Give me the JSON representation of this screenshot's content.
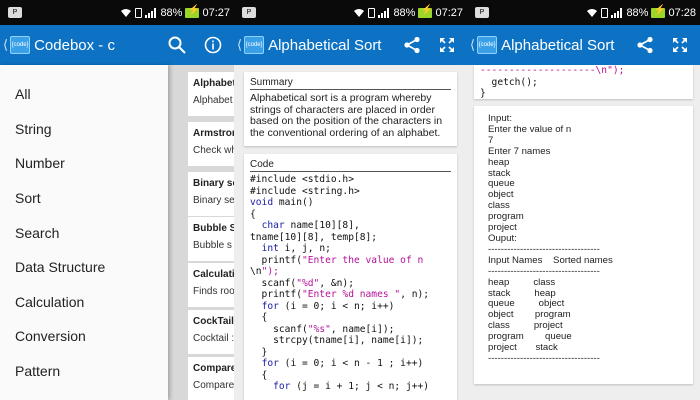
{
  "status_bars": [
    {
      "battery": "88%",
      "time": "07:27"
    },
    {
      "battery": "88%",
      "time": "07:27"
    },
    {
      "battery": "88%",
      "time": "07:28"
    }
  ],
  "app_icon_label": "{code}",
  "screen1": {
    "title": "Codebox - c",
    "menu": [
      "All",
      "String",
      "Number",
      "Sort",
      "Search",
      "Data Structure",
      "Calculation",
      "Conversion",
      "Pattern"
    ],
    "cards": [
      {
        "title": "Alphabet",
        "sub": "Alphabet"
      },
      {
        "title": "Armstror",
        "sub": "Check wh"
      },
      {
        "title": "Binary se",
        "sub": "Binary se"
      },
      {
        "title": "Bubble S",
        "sub": "Bubble s"
      },
      {
        "title": "Calculati",
        "sub": "Finds roo"
      },
      {
        "title": "CockTail",
        "sub": "Cocktail :"
      },
      {
        "title": "Compare",
        "sub": "Compare"
      }
    ]
  },
  "screen2": {
    "title": "Alphabetical Sort",
    "summary_heading": "Summary",
    "summary_text": "Alphabetical sort is a program whereby strings of characters are placed in order based on the position of the characters in the conventional ordering of an alphabet.",
    "code_heading": "Code",
    "code_lines": [
      "#include <stdio.h>",
      "#include <string.h>",
      "void main()",
      "{",
      "  char name[10][8],",
      "tname[10][8], temp[8];",
      "  int i, j, n;",
      "  printf(\"Enter the value of n",
      "\\n\");",
      "  scanf(\"%d\", &n);",
      "  printf(\"Enter %d names \", n);",
      "  for (i = 0; i < n; i++)",
      "  {",
      "    scanf(\"%s\", name[i]);",
      "    strcpy(tname[i], name[i]);",
      "  }",
      "  for (i = 0; i < n - 1 ; i++)",
      "  {",
      "    for (j = i + 1; j < n; j++)"
    ]
  },
  "screen3": {
    "title": "Alphabetical Sort",
    "code_tail": [
      "--------------------\\n\");",
      "  getch();",
      "}"
    ],
    "output_lines": [
      "Input:",
      "Enter the value of n",
      "7",
      "Enter 7 names",
      "heap",
      "stack",
      "queue",
      "object",
      "class",
      "program",
      "project",
      "Ouput:",
      "-----------------------------------",
      "Input Names    Sorted names",
      "-----------------------------------",
      "heap         class",
      "stack         heap",
      "queue         object",
      "object        program",
      "class         project",
      "program        queue",
      "project       stack",
      "-----------------------------------"
    ]
  }
}
